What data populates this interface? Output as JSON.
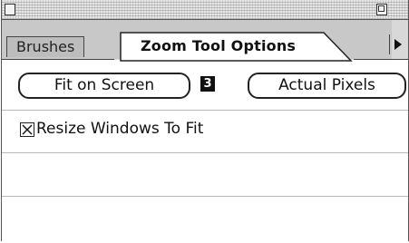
{
  "palette": {
    "tabs": [
      {
        "label": "Brushes",
        "active": false
      },
      {
        "label": "Zoom Tool Options",
        "active": true
      }
    ],
    "buttons": {
      "fit_on_screen": "Fit on Screen",
      "fit_shortcut": "3",
      "actual_pixels": "Actual Pixels"
    },
    "options": {
      "resize_windows_label": "Resize Windows To Fit",
      "resize_windows_checked": true
    }
  },
  "icons": {
    "close": "close-box-icon",
    "zoom": "zoom-box-icon",
    "menu": "palette-menu-arrow-icon",
    "shortcut": "shortcut-3-icon"
  }
}
